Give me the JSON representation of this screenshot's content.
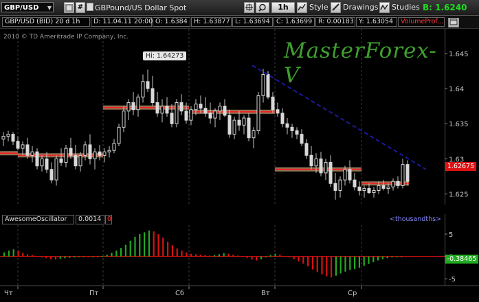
{
  "toolbar": {
    "symbol": "GBP/USD",
    "description": "GBPound/US Dollar Spot",
    "interval": "1h",
    "style_label": "Style",
    "drawings_label": "Drawings",
    "studies_label": "Studies",
    "bid_text": "B: 1.6240",
    "lock_glyph": "#"
  },
  "status": {
    "chart_name": "GBP/USD (BID) 20 d 1h",
    "date": "D: 11.04.11 20:00",
    "open": "O: 1.6384",
    "high": "H: 1.63877",
    "low": "L: 1.63694",
    "close": "C: 1.63699",
    "range": "R: 0.00183",
    "y": "Y: 1.63054",
    "volume_profile": "VolumeProf..."
  },
  "chart": {
    "copyright": "2010 © TD Ameritrade IP Company, Inc.",
    "watermark": "MasterForex-V",
    "hi_label": "Hi: 1.64273",
    "current_price_label": "1.62675",
    "colors": {
      "up": "#22aa22",
      "down": "#dd1111",
      "trendline": "#1a1aa0",
      "watermark": "#3f9f2f",
      "price_tag": "#dd1111",
      "osc_tag": "#22aa22"
    }
  },
  "chart_data": [
    {
      "type": "candlestick",
      "symbol": "GBP/USD",
      "timeframe": "1h",
      "y_ticks": [
        "1.645",
        "1.64",
        "1.635",
        "1.63",
        "1.625"
      ],
      "ylim": [
        1.6235,
        1.6485
      ],
      "x_labels": [
        "Чт",
        "Пт",
        "Сб",
        "Вт",
        "Ср"
      ],
      "candles": [
        [
          1.6328,
          1.6338,
          1.6318,
          1.6332
        ],
        [
          1.6332,
          1.634,
          1.6325,
          1.6335
        ],
        [
          1.6335,
          1.6338,
          1.632,
          1.6325
        ],
        [
          1.6325,
          1.6332,
          1.6312,
          1.6315
        ],
        [
          1.6315,
          1.6325,
          1.6305,
          1.632
        ],
        [
          1.632,
          1.633,
          1.63,
          1.6305
        ],
        [
          1.6305,
          1.6318,
          1.6295,
          1.631
        ],
        [
          1.631,
          1.6315,
          1.6285,
          1.629
        ],
        [
          1.629,
          1.6305,
          1.6282,
          1.63
        ],
        [
          1.63,
          1.631,
          1.628,
          1.6285
        ],
        [
          1.6285,
          1.6295,
          1.6265,
          1.627
        ],
        [
          1.627,
          1.6305,
          1.6262,
          1.63
        ],
        [
          1.63,
          1.6315,
          1.629,
          1.6295
        ],
        [
          1.6295,
          1.632,
          1.6288,
          1.6315
        ],
        [
          1.6315,
          1.633,
          1.63,
          1.6305
        ],
        [
          1.6305,
          1.632,
          1.6285,
          1.629
        ],
        [
          1.629,
          1.631,
          1.6282,
          1.6305
        ],
        [
          1.6305,
          1.6325,
          1.6298,
          1.632
        ],
        [
          1.632,
          1.6335,
          1.6292,
          1.63
        ],
        [
          1.63,
          1.6315,
          1.6285,
          1.631
        ],
        [
          1.631,
          1.632,
          1.6298,
          1.6305
        ],
        [
          1.6305,
          1.6315,
          1.6295,
          1.631
        ],
        [
          1.631,
          1.6318,
          1.6302,
          1.6312
        ],
        [
          1.6312,
          1.6328,
          1.6308,
          1.6322
        ],
        [
          1.6322,
          1.635,
          1.6318,
          1.6345
        ],
        [
          1.6345,
          1.6375,
          1.6338,
          1.6368
        ],
        [
          1.6368,
          1.6385,
          1.6355,
          1.638
        ],
        [
          1.638,
          1.6395,
          1.6362,
          1.637
        ],
        [
          1.637,
          1.6392,
          1.636,
          1.6388
        ],
        [
          1.6388,
          1.642,
          1.638,
          1.641
        ],
        [
          1.641,
          1.6427,
          1.6395,
          1.64
        ],
        [
          1.64,
          1.6418,
          1.6375,
          1.638
        ],
        [
          1.638,
          1.6395,
          1.636,
          1.6365
        ],
        [
          1.6365,
          1.6385,
          1.6352,
          1.6375
        ],
        [
          1.6375,
          1.6388,
          1.636,
          1.6365
        ],
        [
          1.6365,
          1.6378,
          1.6345,
          1.635
        ],
        [
          1.635,
          1.6385,
          1.6345,
          1.638
        ],
        [
          1.638,
          1.6392,
          1.6362,
          1.6368
        ],
        [
          1.6368,
          1.638,
          1.635,
          1.6355
        ],
        [
          1.6355,
          1.6375,
          1.6348,
          1.637
        ],
        [
          1.637,
          1.6385,
          1.6362,
          1.6378
        ],
        [
          1.6378,
          1.639,
          1.6365,
          1.6372
        ],
        [
          1.6372,
          1.6388,
          1.636,
          1.6365
        ],
        [
          1.6365,
          1.638,
          1.635,
          1.6358
        ],
        [
          1.6358,
          1.6372,
          1.6345,
          1.6368
        ],
        [
          1.6368,
          1.638,
          1.6355,
          1.6375
        ],
        [
          1.6375,
          1.6385,
          1.636,
          1.6362
        ],
        [
          1.6362,
          1.637,
          1.633,
          1.6335
        ],
        [
          1.6335,
          1.636,
          1.6328,
          1.6355
        ],
        [
          1.6355,
          1.6368,
          1.634,
          1.6348
        ],
        [
          1.6348,
          1.6362,
          1.6335,
          1.6358
        ],
        [
          1.6358,
          1.6365,
          1.6325,
          1.633
        ],
        [
          1.633,
          1.6345,
          1.6315,
          1.634
        ],
        [
          1.634,
          1.6395,
          1.6335,
          1.639
        ],
        [
          1.639,
          1.6428,
          1.638,
          1.642
        ],
        [
          1.642,
          1.6425,
          1.6385,
          1.6388
        ],
        [
          1.6388,
          1.6395,
          1.6365,
          1.637
        ],
        [
          1.637,
          1.638,
          1.636,
          1.6365
        ],
        [
          1.6365,
          1.6372,
          1.6345,
          1.635
        ],
        [
          1.635,
          1.6358,
          1.6335,
          1.6345
        ],
        [
          1.6345,
          1.635,
          1.633,
          1.634
        ],
        [
          1.634,
          1.6345,
          1.6328,
          1.6335
        ],
        [
          1.6335,
          1.6342,
          1.6318,
          1.6322
        ],
        [
          1.6322,
          1.6328,
          1.63,
          1.6305
        ],
        [
          1.6305,
          1.6318,
          1.6285,
          1.629
        ],
        [
          1.629,
          1.6308,
          1.628,
          1.63
        ],
        [
          1.63,
          1.631,
          1.6275,
          1.628
        ],
        [
          1.628,
          1.63,
          1.627,
          1.6295
        ],
        [
          1.6295,
          1.6305,
          1.626,
          1.6265
        ],
        [
          1.6265,
          1.628,
          1.6242,
          1.6255
        ],
        [
          1.6255,
          1.6275,
          1.6245,
          1.627
        ],
        [
          1.627,
          1.629,
          1.6262,
          1.6285
        ],
        [
          1.6285,
          1.6298,
          1.6265,
          1.627
        ],
        [
          1.627,
          1.628,
          1.6255,
          1.626
        ],
        [
          1.626,
          1.6268,
          1.6248,
          1.6255
        ],
        [
          1.6255,
          1.6262,
          1.6245,
          1.6258
        ],
        [
          1.6258,
          1.6265,
          1.625,
          1.6252
        ],
        [
          1.6252,
          1.626,
          1.6245,
          1.6255
        ],
        [
          1.6255,
          1.6268,
          1.625,
          1.6262
        ],
        [
          1.6262,
          1.627,
          1.6255,
          1.6258
        ],
        [
          1.6258,
          1.6265,
          1.625,
          1.626
        ],
        [
          1.626,
          1.6272,
          1.6255,
          1.6268
        ],
        [
          1.6268,
          1.6275,
          1.6258,
          1.6262
        ],
        [
          1.6262,
          1.63,
          1.6258,
          1.6292
        ],
        [
          1.6292,
          1.6298,
          1.6262,
          1.6268
        ]
      ]
    },
    {
      "type": "bar",
      "title": "AwesomeOscillator",
      "value_label": "0.0014",
      "second_label": "0",
      "units_label": "<thousandths>",
      "y_ticks": [
        "5",
        "0",
        "-5"
      ],
      "ylim": [
        -6.5,
        7
      ],
      "current_value_label": "-0.38465",
      "values": [
        0.9,
        1.3,
        1.6,
        1.2,
        0.8,
        0.5,
        0.3,
        0.1,
        -0.2,
        -0.4,
        -0.6,
        -0.7,
        -0.5,
        -0.4,
        -0.3,
        -0.2,
        -0.1,
        0.0,
        -0.2,
        -0.1,
        0.0,
        0.1,
        0.4,
        0.8,
        1.3,
        1.9,
        2.6,
        3.5,
        4.4,
        5.0,
        5.4,
        5.8,
        5.6,
        5.0,
        4.2,
        3.3,
        2.5,
        1.8,
        1.3,
        0.9,
        0.6,
        0.5,
        0.4,
        0.3,
        0.2,
        0.3,
        0.5,
        0.7,
        0.6,
        0.4,
        0.2,
        0.1,
        -0.3,
        -0.7,
        -0.9,
        -0.6,
        -0.2,
        0.3,
        0.6,
        0.4,
        0.1,
        -0.2,
        -0.6,
        -1.1,
        -1.6,
        -2.2,
        -2.9,
        -3.5,
        -4.0,
        -4.4,
        -4.7,
        -4.3,
        -3.8,
        -3.4,
        -3.0,
        -2.8,
        -2.5,
        -2.1,
        -1.7,
        -1.3,
        -0.9,
        -0.6,
        -0.4,
        -0.2,
        -0.1,
        0.0
      ]
    }
  ]
}
